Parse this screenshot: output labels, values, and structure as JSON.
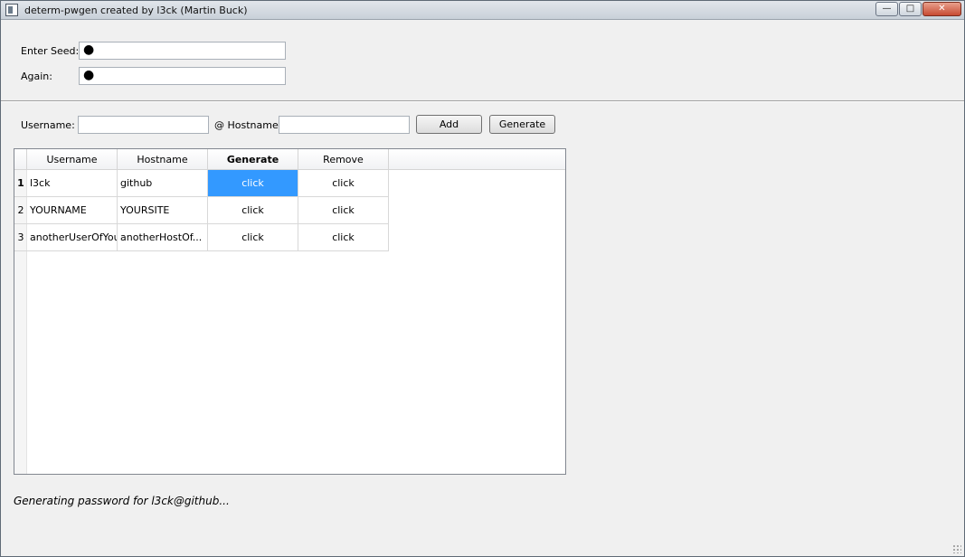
{
  "window": {
    "title": "determ-pwgen created by l3ck (Martin Buck)",
    "buttons": {
      "minimize": "—",
      "maximize": "□",
      "close": "✕"
    }
  },
  "seed": {
    "seed_label": "Enter Seed:",
    "seed_value": "●",
    "again_label": "Again:",
    "again_value": "●"
  },
  "entry": {
    "username_label": "Username:",
    "username_value": "",
    "hostname_label": "@ Hostname:",
    "hostname_value": "",
    "add_label": "Add",
    "generate_label": "Generate"
  },
  "table": {
    "columns": [
      "Username",
      "Hostname",
      "Generate",
      "Remove"
    ],
    "rows": [
      {
        "num": "1",
        "username": "l3ck",
        "hostname": "github",
        "generate": "click",
        "remove": "click"
      },
      {
        "num": "2",
        "username": "YOURNAME",
        "hostname": "YOURSITE",
        "generate": "click",
        "remove": "click"
      },
      {
        "num": "3",
        "username": "anotherUserOfYou",
        "hostname": "anotherHostOf...",
        "generate": "click",
        "remove": "click"
      }
    ]
  },
  "status": {
    "text": "Generating password for l3ck@github..."
  },
  "colors": {
    "selection": "#3399ff",
    "window_bg": "#f0f0f0"
  }
}
